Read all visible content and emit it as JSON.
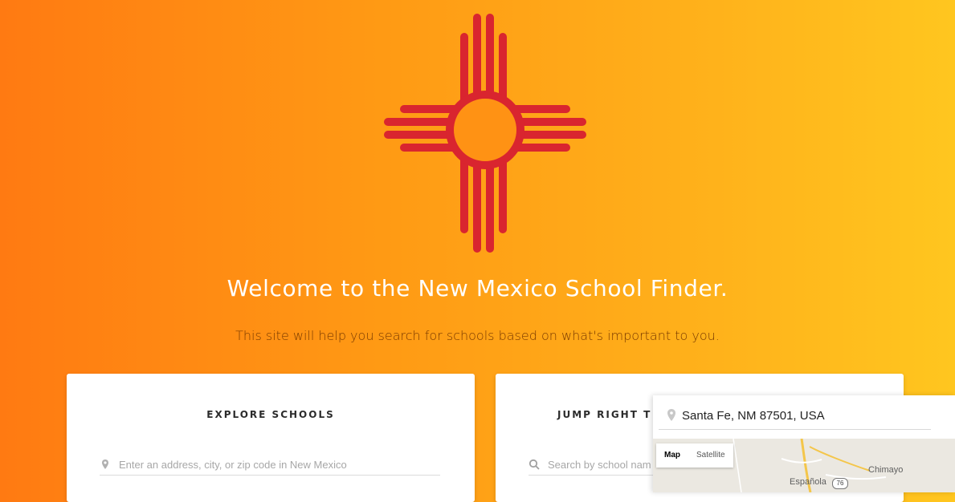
{
  "hero": {
    "headline": "Welcome to the New Mexico School Finder.",
    "subline": "This site will help you search for schools based on what's important to you."
  },
  "colors": {
    "gradient_start": "#ff7a12",
    "gradient_end": "#ffc61f",
    "zia_red": "#d9252f"
  },
  "explore": {
    "title": "EXPLORE SCHOOLS",
    "placeholder": "Enter an address, city, or zip code in New Mexico",
    "icon": "map-pin-icon"
  },
  "jump": {
    "title": "JUMP RIGHT T",
    "placeholder": "Search by school nam",
    "icon": "search-icon"
  },
  "map": {
    "search_value": "Santa Fe, NM 87501, USA",
    "toggle_map": "Map",
    "toggle_satellite": "Satellite",
    "labels": {
      "chimayo": "Chimayo",
      "espanola": "Española",
      "hwy": "76"
    }
  }
}
